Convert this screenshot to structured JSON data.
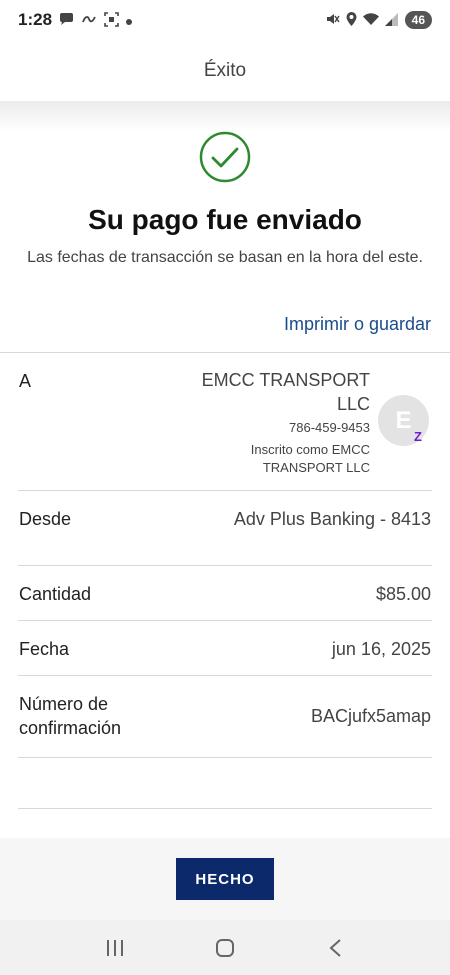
{
  "status_bar": {
    "time": "1:28",
    "battery": "46",
    "left_icons": [
      "chat-bubble-icon",
      "link-icon",
      "screenshot-icon",
      "dot-icon"
    ],
    "right_icons": [
      "mute-icon",
      "location-icon",
      "wifi-icon",
      "signal-icon"
    ]
  },
  "header": {
    "title": "Éxito"
  },
  "success": {
    "headline": "Su pago fue enviado",
    "subtext": "Las fechas de transacción se basan en la hora del este.",
    "print_link": "Imprimir o guardar",
    "accent_color": "#2f8a2f"
  },
  "details": {
    "to": {
      "label": "A",
      "name": "EMCC TRANSPORT LLC",
      "phone": "786-459-9453",
      "enrolled": "Inscrito como EMCC TRANSPORT LLC",
      "avatar_initial": "E",
      "badge": "Z"
    },
    "from": {
      "label": "Desde",
      "value": "Adv Plus Banking - 8413"
    },
    "amount": {
      "label": "Cantidad",
      "value": "$85.00"
    },
    "date": {
      "label": "Fecha",
      "value": "jun 16, 2025"
    },
    "confirmation": {
      "label": "Número de confirmación",
      "value": "BACjufx5amap"
    }
  },
  "footer": {
    "done_label": "HECHO",
    "button_color": "#0c2a6b"
  },
  "nav": {
    "buttons": [
      "recent-apps-icon",
      "home-icon",
      "back-icon"
    ]
  }
}
